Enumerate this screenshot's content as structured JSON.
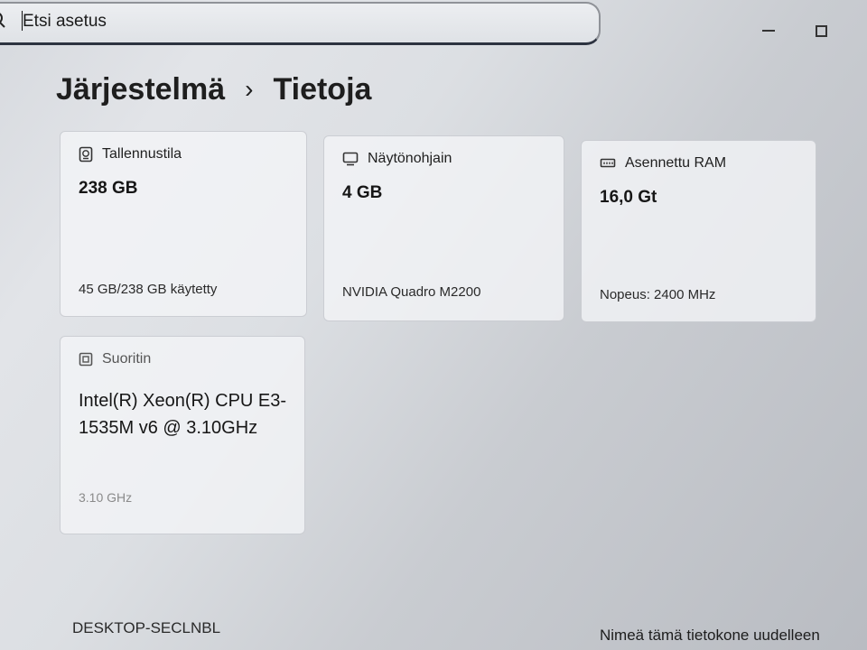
{
  "search": {
    "placeholder": "Etsi asetus"
  },
  "window_controls": {
    "minimize_icon": "minimize-icon",
    "maximize_icon": "maximize-icon"
  },
  "breadcrumb": {
    "parent": "Järjestelmä",
    "separator": "›",
    "current": "Tietoja"
  },
  "cards": {
    "storage": {
      "icon": "hard-drive-icon",
      "title": "Tallennustila",
      "value": "238 GB",
      "detail": "45 GB/238 GB käytetty"
    },
    "gpu": {
      "icon": "monitor-icon",
      "title": "Näytönohjain",
      "value": "4 GB",
      "detail": "NVIDIA Quadro M2200"
    },
    "ram": {
      "icon": "memory-icon",
      "title": "Asennettu RAM",
      "value": "16,0 Gt",
      "detail": "Nopeus: 2400 MHz"
    },
    "cpu": {
      "icon": "processor-icon",
      "title": "Suoritin",
      "value": "Intel(R) Xeon(R) CPU E3-1535M v6 @ 3.10GHz",
      "detail": "3.10 GHz"
    }
  },
  "device": {
    "name": "DESKTOP-SECLNBL",
    "rename_label": "Nimeä tämä tietokone uudelleen"
  },
  "colors": {
    "background": "#d6d9de",
    "card_background": "#f4f5f7",
    "search_border_accent": "#2d3340"
  }
}
